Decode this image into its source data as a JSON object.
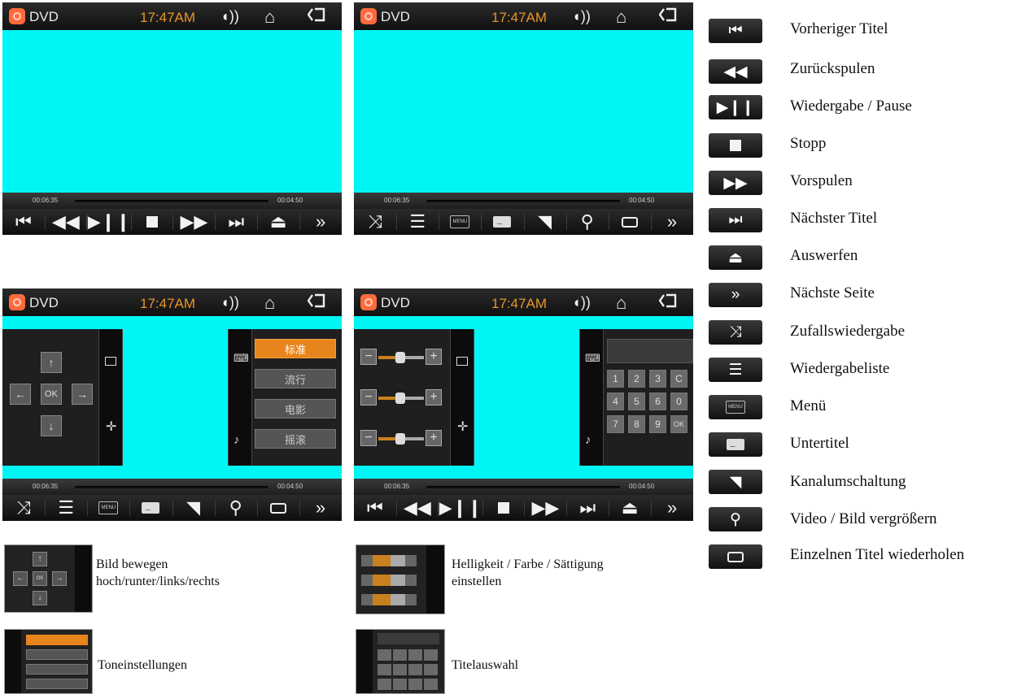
{
  "header": {
    "app_name": "DVD",
    "time": "17:47AM"
  },
  "progress": {
    "elapsed": "00:06:35",
    "remaining": "00:04:50"
  },
  "controls_page1": [
    "prev-track-icon",
    "rewind-icon",
    "play-pause-icon",
    "stop-icon",
    "fast-forward-icon",
    "next-track-icon",
    "eject-icon",
    "next-page-icon"
  ],
  "controls_page2": [
    "shuffle-icon",
    "playlist-icon",
    "menu-icon",
    "subtitle-icon",
    "channel-icon",
    "zoom-icon",
    "repeat-icon",
    "next-page-icon"
  ],
  "menu_icon_text": "MENU",
  "dpad": {
    "ok": "OK"
  },
  "sound_modes": [
    "标准",
    "流行",
    "电影",
    "摇滚"
  ],
  "numpad": [
    "1",
    "2",
    "3",
    "C",
    "4",
    "5",
    "6",
    "0",
    "7",
    "8",
    "9",
    "OK"
  ],
  "legend": [
    {
      "icon": "prev-track-icon",
      "label": "Vorheriger Titel"
    },
    {
      "icon": "rewind-icon",
      "label": "Zurückspulen"
    },
    {
      "icon": "play-pause-icon",
      "label": "Wiedergabe / Pause"
    },
    {
      "icon": "stop-icon",
      "label": "Stopp"
    },
    {
      "icon": "fast-forward-icon",
      "label": "Vorspulen"
    },
    {
      "icon": "next-track-icon",
      "label": "Nächster Titel"
    },
    {
      "icon": "eject-icon",
      "label": "Auswerfen"
    },
    {
      "icon": "next-page-icon",
      "label": "Nächste Seite"
    },
    {
      "icon": "shuffle-icon",
      "label": "Zufallswiedergabe"
    },
    {
      "icon": "playlist-icon",
      "label": "Wiedergabeliste"
    },
    {
      "icon": "menu-icon",
      "label": "Menü"
    },
    {
      "icon": "subtitle-icon",
      "label": "Untertitel"
    },
    {
      "icon": "channel-icon",
      "label": "Kanalumschaltung"
    },
    {
      "icon": "zoom-icon",
      "label": "Video / Bild vergrößern"
    },
    {
      "icon": "repeat-icon",
      "label": "Einzelnen Titel wiederholen"
    }
  ],
  "captions": {
    "move": [
      "Bild bewegen",
      "hoch/runter/links/rechts"
    ],
    "picture": [
      "Helligkeit / Farbe / Sättigung",
      "einstellen"
    ],
    "sound": "Toneinstellungen",
    "title": "Titelauswahl"
  },
  "colors": {
    "screen": "#00f5f5",
    "accent": "#e79528",
    "bar": "#151515"
  }
}
